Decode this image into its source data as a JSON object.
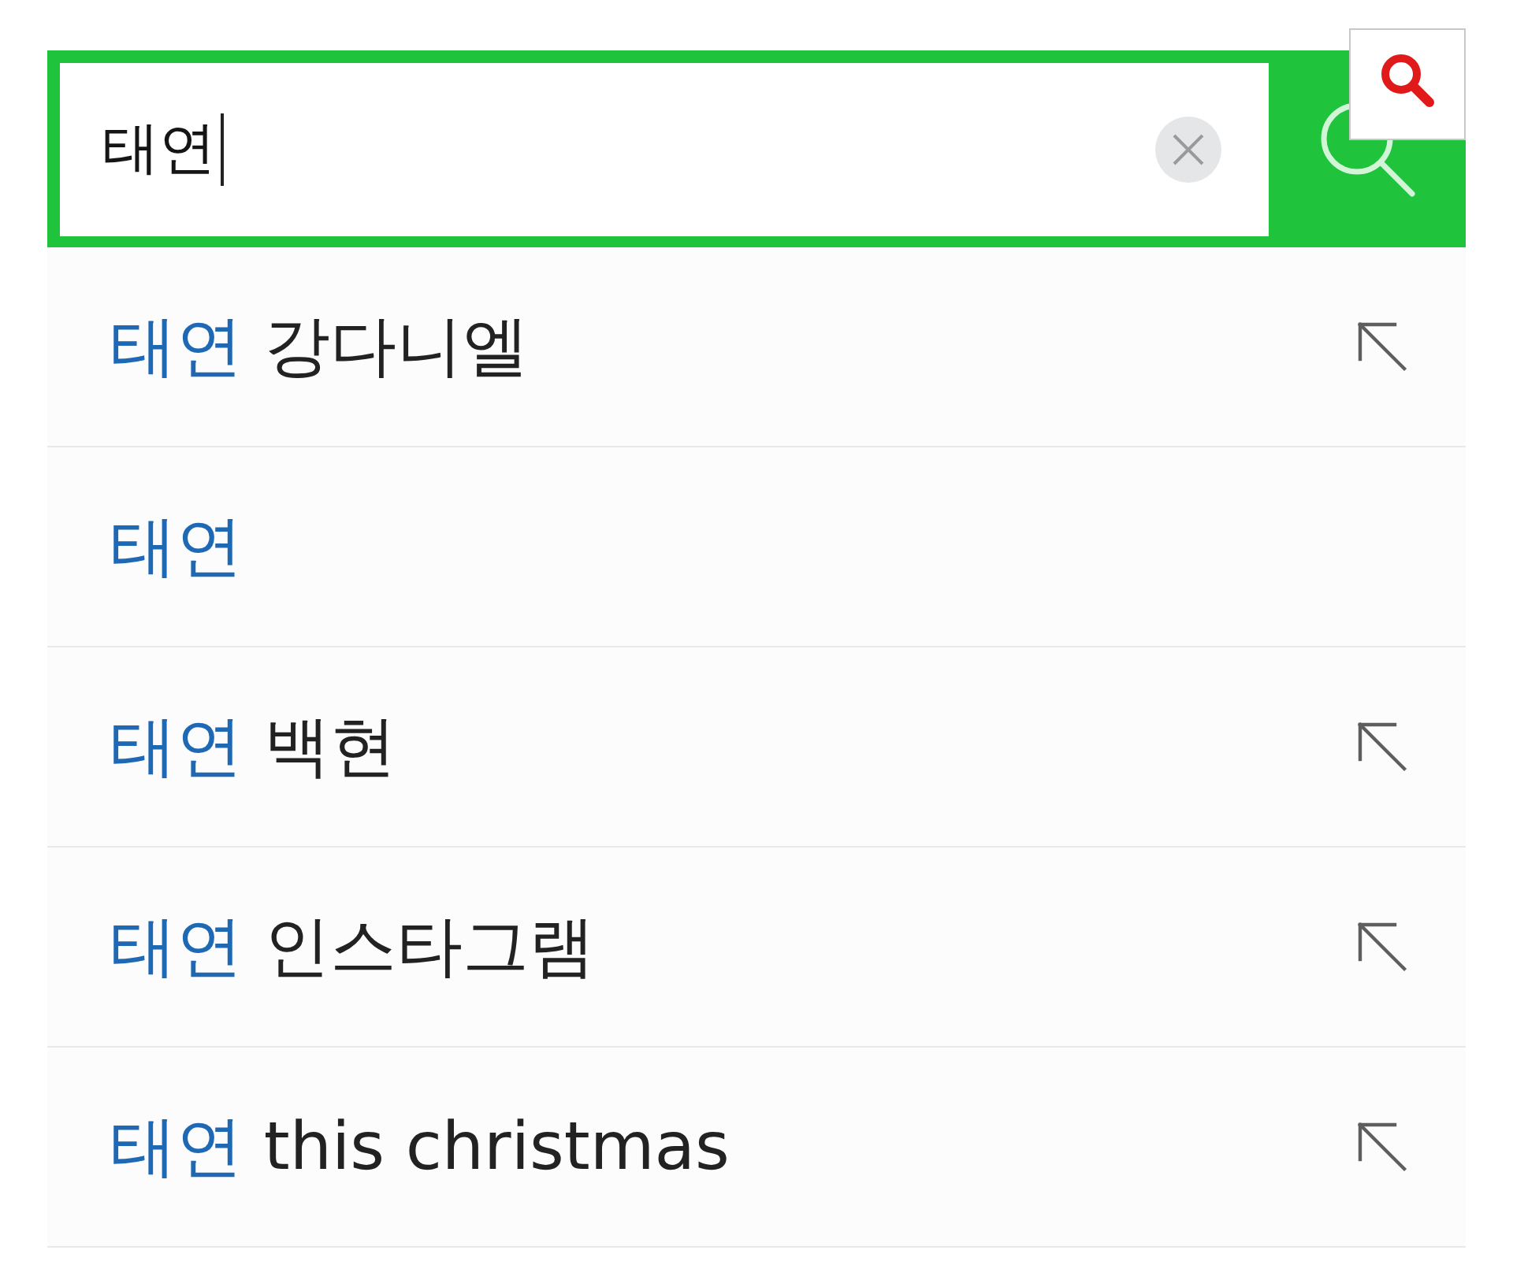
{
  "search": {
    "value": "태연",
    "focused": true
  },
  "suggestions": [
    {
      "match": "태연",
      "rest": "강다니엘",
      "fill_in": true
    },
    {
      "match": "태연",
      "fill_in": false
    },
    {
      "match": "태연",
      "rest": "백현",
      "fill_in": true
    },
    {
      "match": "태연",
      "rest": "인스타그램",
      "fill_in": true
    },
    {
      "match": "태연",
      "rest": "this christmas",
      "fill_in": true
    }
  ]
}
